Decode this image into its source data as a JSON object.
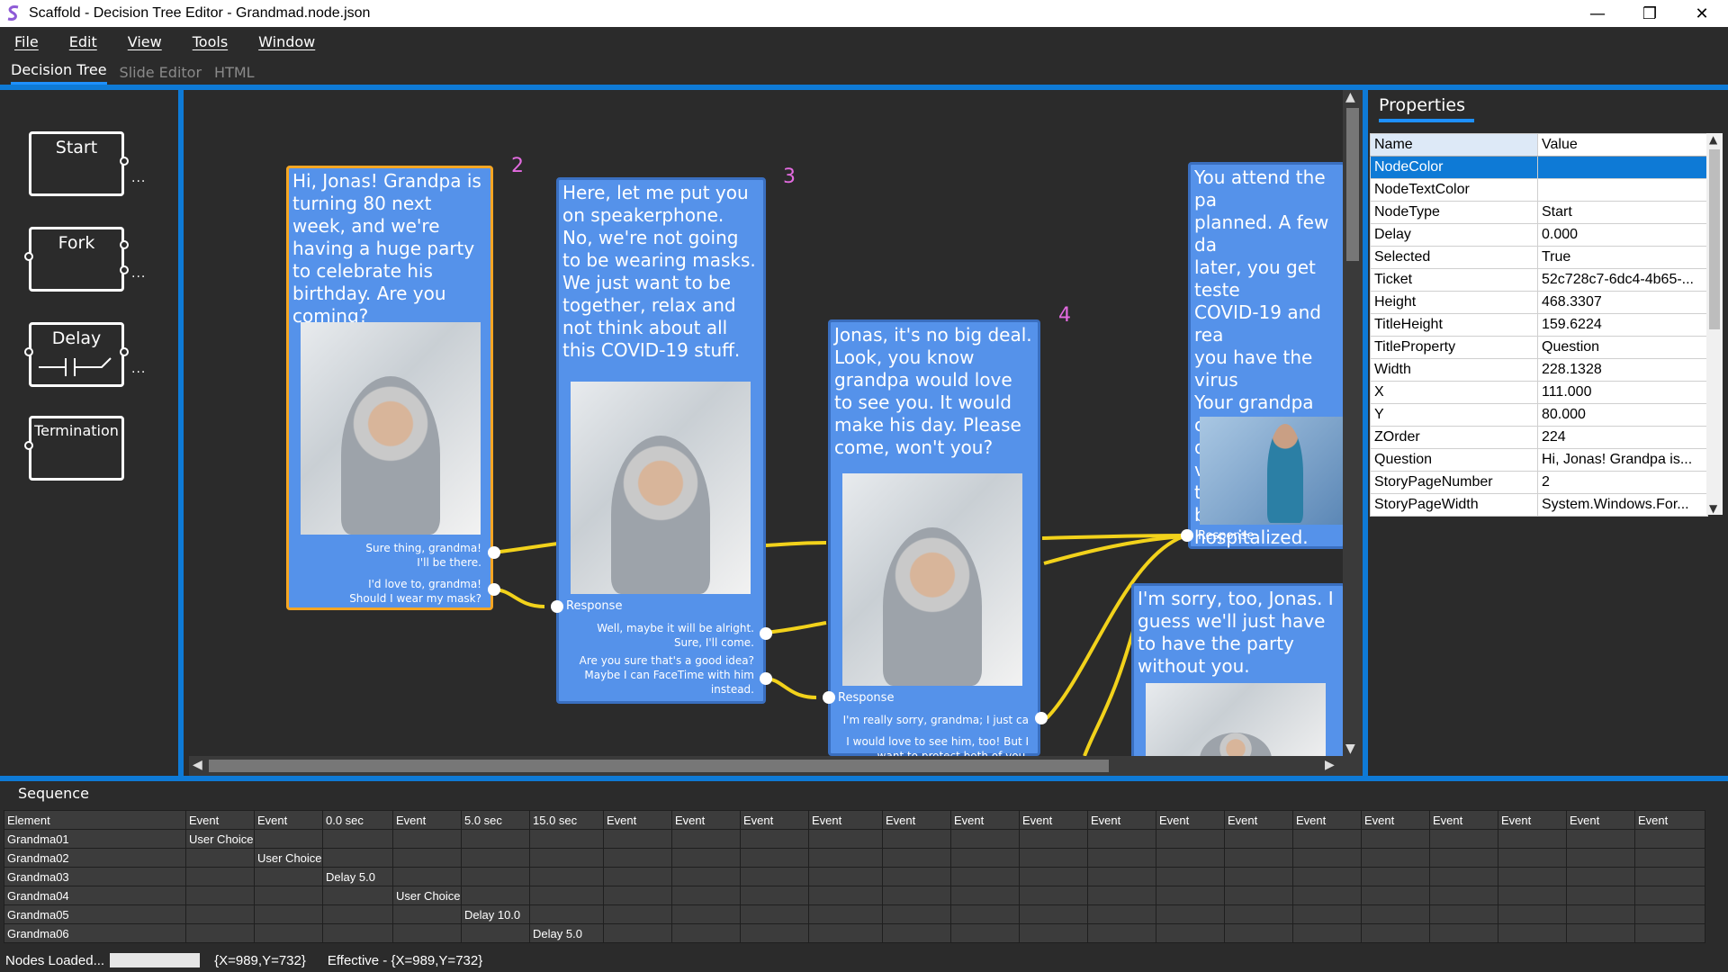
{
  "window": {
    "title": "Scaffold - Decision Tree Editor - Grandmad.node.json",
    "controls": {
      "minimize": "—",
      "restore": "❐",
      "close": "✕"
    }
  },
  "menu": [
    "File",
    "Edit",
    "View",
    "Tools",
    "Window"
  ],
  "tabs": [
    {
      "label": "Decision Tree",
      "active": true
    },
    {
      "label": "Slide Editor",
      "active": false
    },
    {
      "label": "HTML",
      "active": false
    }
  ],
  "palette": {
    "items": [
      "Start",
      "Fork",
      "Delay",
      "Termination"
    ],
    "dots": "..."
  },
  "nodes": [
    {
      "number": "2",
      "question": "Hi, Jonas! Grandpa is turning 80 next week, and we're having a huge party to celebrate his birthday. Are you coming?",
      "responses": [
        "Sure thing, grandma!\nI'll be there.",
        "I'd love to, grandma!\nShould I wear my mask?"
      ]
    },
    {
      "number": "3",
      "question": "Here, let me put you on speakerphone.\nNo, we're not going to be wearing masks. We just want to be together, relax and not think about all this COVID-19 stuff.",
      "response_label": "Response",
      "responses": [
        "Well, maybe it will be alright.\nSure, I'll come.",
        "Are you sure that's a good idea?\nMaybe I can FaceTime with him\ninstead."
      ]
    },
    {
      "number": "4",
      "question": "Jonas, it's no big deal. Look, you know grandpa would love to see you. It would make his day. Please come, won't you?",
      "response_label": "Response",
      "responses": [
        "I'm really sorry, grandma; I just ca",
        "I would love to see him, too! But I\nwant to protect both of you."
      ]
    },
    {
      "question": "You attend the pa\nplanned. A few da\nlater, you get teste\nCOVID-19 and rea\nyou have the virus\nYour grandpa com\ndown with the viru\ntoo, and must be\nhospitalized.",
      "response_label": "Response"
    },
    {
      "question": "I'm sorry, too, Jonas. I guess we'll just have to have the party without you."
    }
  ],
  "properties": {
    "title": "Properties",
    "columns": [
      "Name",
      "Value"
    ],
    "rows": [
      {
        "name": "NodeColor",
        "value": ""
      },
      {
        "name": "NodeTextColor",
        "value": ""
      },
      {
        "name": "NodeType",
        "value": "Start"
      },
      {
        "name": "Delay",
        "value": "0.000"
      },
      {
        "name": "Selected",
        "value": "True"
      },
      {
        "name": "Ticket",
        "value": "52c728c7-6dc4-4b65-..."
      },
      {
        "name": "Height",
        "value": "468.3307"
      },
      {
        "name": "TitleHeight",
        "value": "159.6224"
      },
      {
        "name": "TitleProperty",
        "value": "Question"
      },
      {
        "name": "Width",
        "value": "228.1328"
      },
      {
        "name": "X",
        "value": "111.000"
      },
      {
        "name": "Y",
        "value": "80.000"
      },
      {
        "name": "ZOrder",
        "value": "224"
      },
      {
        "name": "Question",
        "value": "Hi, Jonas! Grandpa is..."
      },
      {
        "name": "StoryPageNumber",
        "value": "2"
      },
      {
        "name": "StoryPageWidth",
        "value": "System.Windows.For..."
      }
    ]
  },
  "sequence": {
    "title": "Sequence",
    "headers": [
      "Element",
      "Event",
      "Event",
      "0.0 sec",
      "Event",
      "5.0 sec",
      "15.0 sec",
      "Event",
      "Event",
      "Event",
      "Event",
      "Event",
      "Event",
      "Event",
      "Event",
      "Event",
      "Event",
      "Event",
      "Event",
      "Event",
      "Event",
      "Event",
      "Event"
    ],
    "rows": [
      [
        "Grandma01",
        "User Choice",
        "",
        "",
        "",
        "",
        "",
        "",
        "",
        "",
        "",
        "",
        "",
        "",
        "",
        "",
        "",
        "",
        "",
        "",
        "",
        "",
        ""
      ],
      [
        "Grandma02",
        "",
        "User Choice",
        "",
        "",
        "",
        "",
        "",
        "",
        "",
        "",
        "",
        "",
        "",
        "",
        "",
        "",
        "",
        "",
        "",
        "",
        "",
        ""
      ],
      [
        "Grandma03",
        "",
        "",
        "Delay 5.0",
        "",
        "",
        "",
        "",
        "",
        "",
        "",
        "",
        "",
        "",
        "",
        "",
        "",
        "",
        "",
        "",
        "",
        "",
        ""
      ],
      [
        "Grandma04",
        "",
        "",
        "",
        "User Choice",
        "",
        "",
        "",
        "",
        "",
        "",
        "",
        "",
        "",
        "",
        "",
        "",
        "",
        "",
        "",
        "",
        "",
        ""
      ],
      [
        "Grandma05",
        "",
        "",
        "",
        "",
        "Delay 10.0",
        "",
        "",
        "",
        "",
        "",
        "",
        "",
        "",
        "",
        "",
        "",
        "",
        "",
        "",
        "",
        "",
        ""
      ],
      [
        "Grandma06",
        "",
        "",
        "",
        "",
        "",
        "Delay 5.0",
        "",
        "",
        "",
        "",
        "",
        "",
        "",
        "",
        "",
        "",
        "",
        "",
        "",
        "",
        "",
        ""
      ]
    ]
  },
  "status": {
    "text": "Nodes Loaded...",
    "coords": "{X=989,Y=732}",
    "effective": "Effective - {X=989,Y=732}"
  },
  "colors": {
    "accent": "#0e7ad6",
    "node_fill": "#5592ea",
    "selected_border": "#f5a623",
    "connector": "#f2d21b",
    "node_number": "#e36be0"
  }
}
